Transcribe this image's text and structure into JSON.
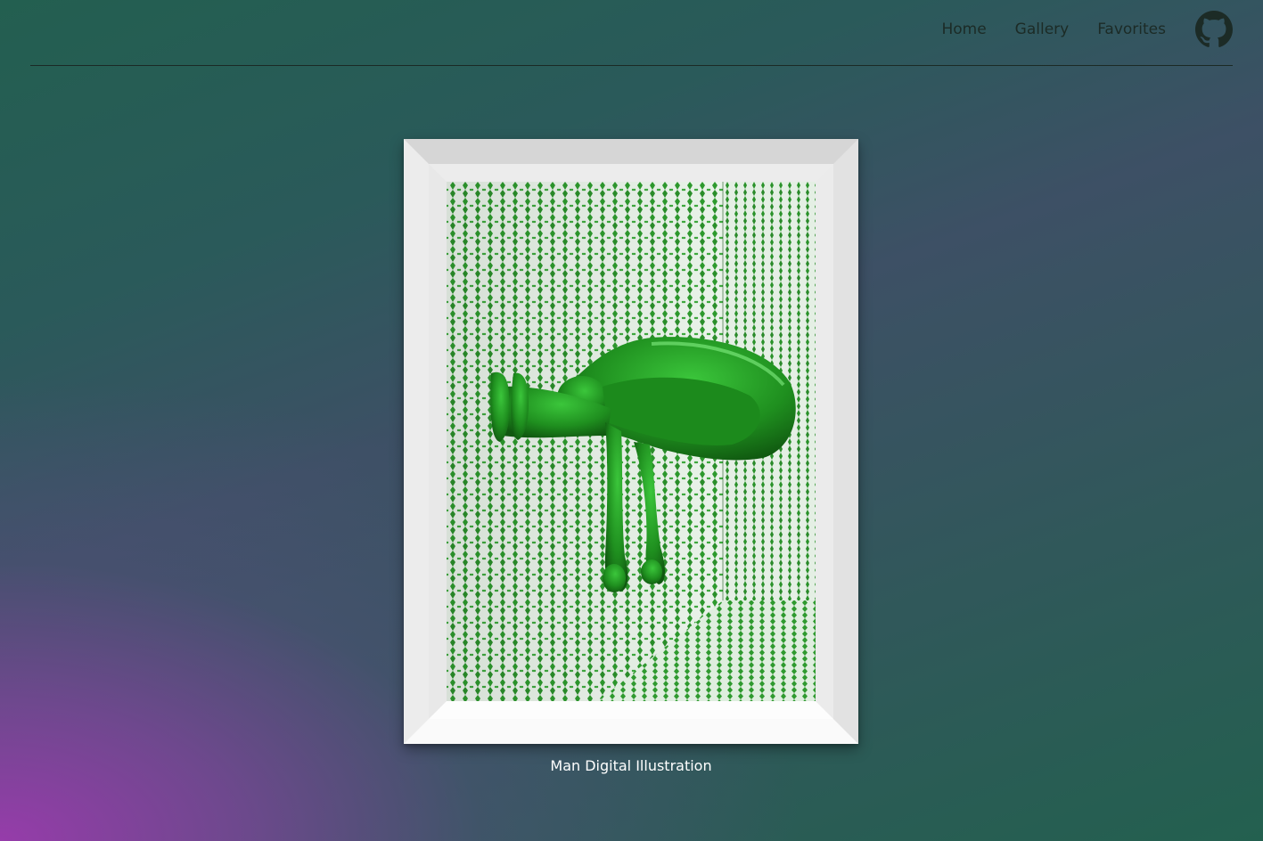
{
  "nav": {
    "links": [
      "Home",
      "Gallery",
      "Favorites"
    ],
    "github_icon": "github-icon"
  },
  "artwork": {
    "caption": "Man Digital Illustration",
    "image_description_icon": "artwork-image"
  },
  "colors": {
    "nav_text": "#1c2b26",
    "caption_text": "#ffffff",
    "frame": "#f1f1f1",
    "figure_green": "#1f8a1f"
  }
}
